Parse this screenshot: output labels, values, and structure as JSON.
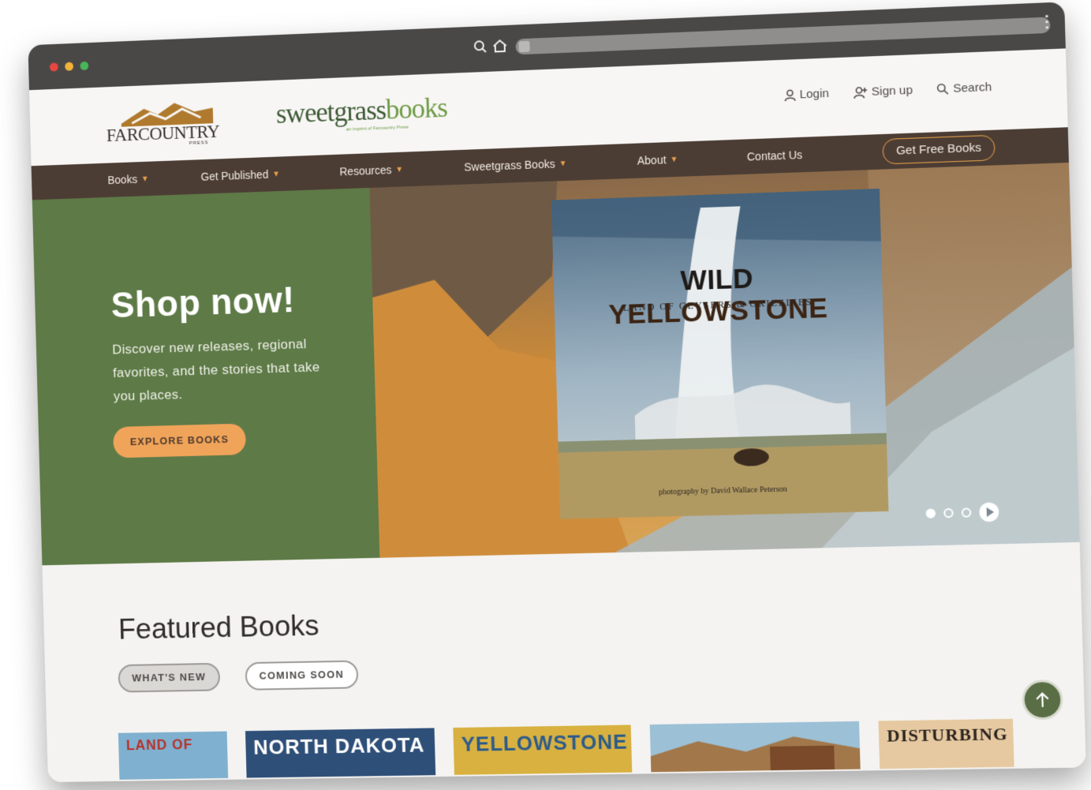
{
  "browser": {
    "window_controls": [
      "close",
      "minimize",
      "maximize"
    ],
    "icons": [
      "search-icon",
      "home-icon",
      "menu-icon"
    ]
  },
  "header": {
    "logo_farcountry": "FARCOUNTRY",
    "logo_farcountry_sub": "PRESS",
    "logo_sweetgrass_a": "sweetgrass",
    "logo_sweetgrass_b": "books",
    "logo_sweetgrass_tag": "an imprint of Farcountry Press",
    "login": "Login",
    "signup": "Sign up",
    "search": "Search"
  },
  "nav": {
    "items": [
      {
        "label": "Books"
      },
      {
        "label": "Get Published"
      },
      {
        "label": "Resources"
      },
      {
        "label": "Sweetgrass Books"
      },
      {
        "label": "About"
      },
      {
        "label": "Contact Us"
      }
    ],
    "cta": "Get Free Books"
  },
  "hero": {
    "title": "Shop now!",
    "description": "Discover new releases, regional favorites, and the stories that take you places.",
    "button": "EXPLORE BOOKS",
    "book_title_a": "WILD ",
    "book_title_b": "YELLOWSTONE",
    "book_subtitle": "LAND OF GEYSERS & GRIZZLIES",
    "book_credit": "photography by David Wallace Peterson",
    "carousel_slide": 1,
    "carousel_total": 3
  },
  "featured": {
    "title": "Featured Books",
    "tabs": [
      {
        "label": "WHAT'S NEW",
        "active": true
      },
      {
        "label": "COMING SOON",
        "active": false
      }
    ],
    "books": [
      {
        "title": "LAND OF"
      },
      {
        "title": "NORTH DAKOTA"
      },
      {
        "title": "YELLOWSTONE"
      },
      {
        "title": ""
      },
      {
        "title": "DISTURBING"
      }
    ]
  },
  "colors": {
    "nav_bg": "#4c3d34",
    "hero_green": "#5e7a47",
    "accent_orange": "#f0a45a",
    "brand_green": "#6f9a46"
  }
}
